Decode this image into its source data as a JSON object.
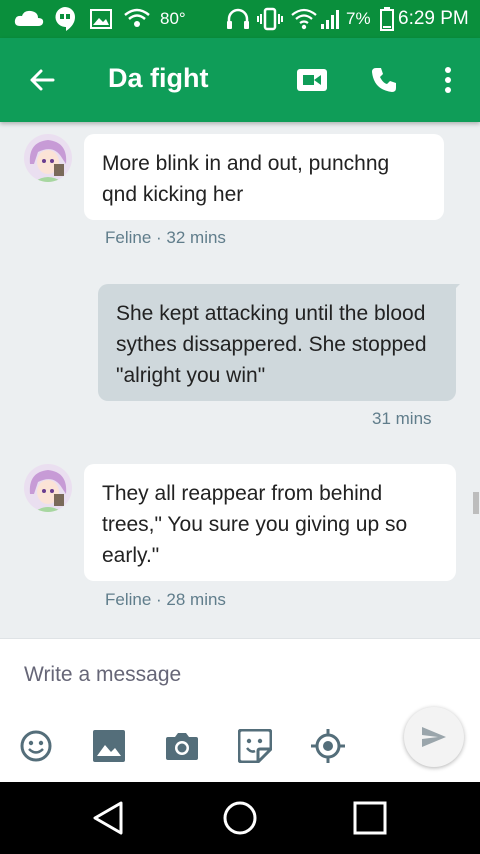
{
  "status_bar": {
    "battery_text": "7%",
    "time": "6:29 PM",
    "temperature": "80°"
  },
  "app_bar": {
    "title": "Da fight",
    "icons": [
      "back-arrow-icon",
      "video-call-icon",
      "phone-call-icon",
      "more-vert-icon"
    ]
  },
  "messages": [
    {
      "direction": "incoming",
      "text": "More blink in and out, punchng qnd kicking her",
      "meta": "Feline · 32 mins"
    },
    {
      "direction": "outgoing",
      "text": "She kept attacking until the blood sythes dissappered. She stopped \"alright you win\"",
      "meta": "31 mins"
    },
    {
      "direction": "incoming",
      "text": "They all reappear from behind trees,\" You sure you giving up so early.\"",
      "meta": "Feline · 28 mins"
    }
  ],
  "composer": {
    "placeholder": "Write a message",
    "tools": [
      "emoji-icon",
      "image-icon",
      "camera-icon",
      "sticker-icon",
      "location-icon",
      "send-icon"
    ]
  },
  "nav_bar": {
    "icons": [
      "back-nav-icon",
      "home-nav-icon",
      "recents-nav-icon"
    ]
  },
  "colors": {
    "status_bar": "#0a8f3c",
    "app_bar": "#0f9d58",
    "outgoing_bubble": "#cfd8dc",
    "chat_background": "#eceff1"
  }
}
